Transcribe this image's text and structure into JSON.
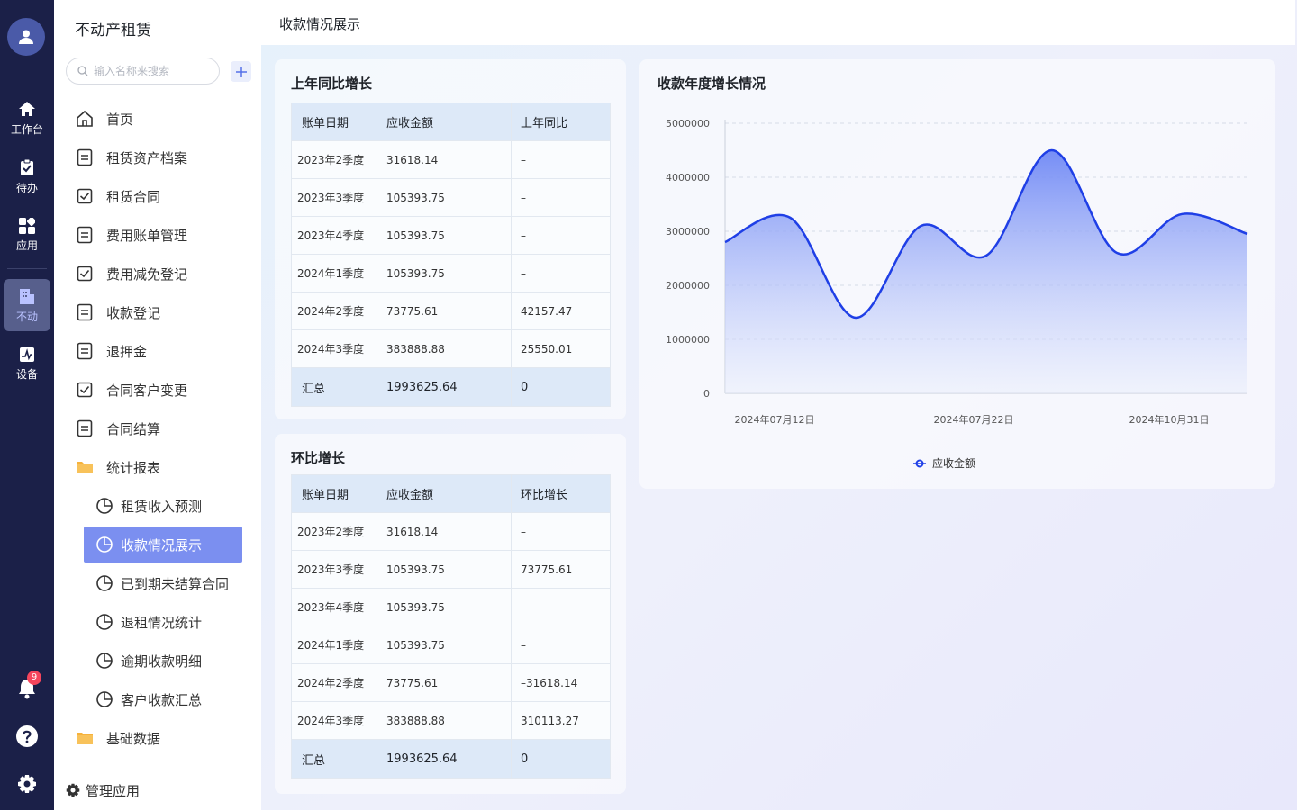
{
  "rail": {
    "items": [
      {
        "label": "工作台",
        "icon": "home-icon"
      },
      {
        "label": "待办",
        "icon": "clipboard-icon"
      },
      {
        "label": "应用",
        "icon": "apps-icon"
      },
      {
        "label": "不动",
        "icon": "building-icon"
      },
      {
        "label": "设备",
        "icon": "device-icon"
      }
    ],
    "notification_count": "9"
  },
  "sidebar": {
    "title": "不动产租赁",
    "search_placeholder": "输入名称来搜索",
    "items": [
      {
        "label": "首页",
        "icon": "home-outline-icon"
      },
      {
        "label": "租赁资产档案",
        "icon": "document-icon"
      },
      {
        "label": "租赁合同",
        "icon": "checkbox-icon"
      },
      {
        "label": "费用账单管理",
        "icon": "document-icon"
      },
      {
        "label": "费用减免登记",
        "icon": "checkbox-icon"
      },
      {
        "label": "收款登记",
        "icon": "document-icon"
      },
      {
        "label": "退押金",
        "icon": "document-icon"
      },
      {
        "label": "合同客户变更",
        "icon": "checkbox-icon"
      },
      {
        "label": "合同结算",
        "icon": "document-icon"
      },
      {
        "label": "统计报表",
        "icon": "folder-icon"
      },
      {
        "label": "租赁收入预测",
        "icon": "pie-chart-icon"
      },
      {
        "label": "收款情况展示",
        "icon": "pie-chart-icon"
      },
      {
        "label": "已到期未结算合同",
        "icon": "pie-chart-icon"
      },
      {
        "label": "退租情况统计",
        "icon": "pie-chart-icon"
      },
      {
        "label": "逾期收款明细",
        "icon": "pie-chart-icon"
      },
      {
        "label": "客户收款汇总",
        "icon": "pie-chart-icon"
      },
      {
        "label": "基础数据",
        "icon": "folder-icon"
      }
    ],
    "footer": "管理应用"
  },
  "page": {
    "title": "收款情况展示"
  },
  "yoy": {
    "title": "上年同比增长",
    "headers": [
      "账单日期",
      "应收金额",
      "上年同比"
    ],
    "rows": [
      [
        "2023年2季度",
        "31618.14",
        "–"
      ],
      [
        "2023年3季度",
        "105393.75",
        "–"
      ],
      [
        "2023年4季度",
        "105393.75",
        "–"
      ],
      [
        "2024年1季度",
        "105393.75",
        "–"
      ],
      [
        "2024年2季度",
        "73775.61",
        "42157.47"
      ],
      [
        "2024年3季度",
        "383888.88",
        "25550.01"
      ]
    ],
    "total": [
      "汇总",
      "1993625.64",
      "0"
    ]
  },
  "mom": {
    "title": "环比增长",
    "headers": [
      "账单日期",
      "应收金额",
      "环比增长"
    ],
    "rows": [
      [
        "2023年2季度",
        "31618.14",
        "–"
      ],
      [
        "2023年3季度",
        "105393.75",
        "73775.61"
      ],
      [
        "2023年4季度",
        "105393.75",
        "–"
      ],
      [
        "2024年1季度",
        "105393.75",
        "–"
      ],
      [
        "2024年2季度",
        "73775.61",
        "–31618.14"
      ],
      [
        "2024年3季度",
        "383888.88",
        "310113.27"
      ]
    ],
    "total": [
      "汇总",
      "1993625.64",
      "0"
    ]
  },
  "chart_title": "收款年度增长情况",
  "chart_data": {
    "type": "area",
    "title": "收款年度增长情况",
    "x_tick_labels": [
      "2024年07月12日",
      "2024年07月22日",
      "2024年10月31日"
    ],
    "y_ticks": [
      0,
      1000000,
      2000000,
      3000000,
      4000000,
      5000000
    ],
    "ylim": [
      0,
      5000000
    ],
    "grid": true,
    "legend_position": "bottom-center",
    "series": [
      {
        "name": "应收金额",
        "color": "#1f3fe6",
        "values": [
          2800000,
          3250000,
          1400000,
          3100000,
          2550000,
          4500000,
          2600000,
          3320000,
          2950000
        ]
      }
    ]
  }
}
